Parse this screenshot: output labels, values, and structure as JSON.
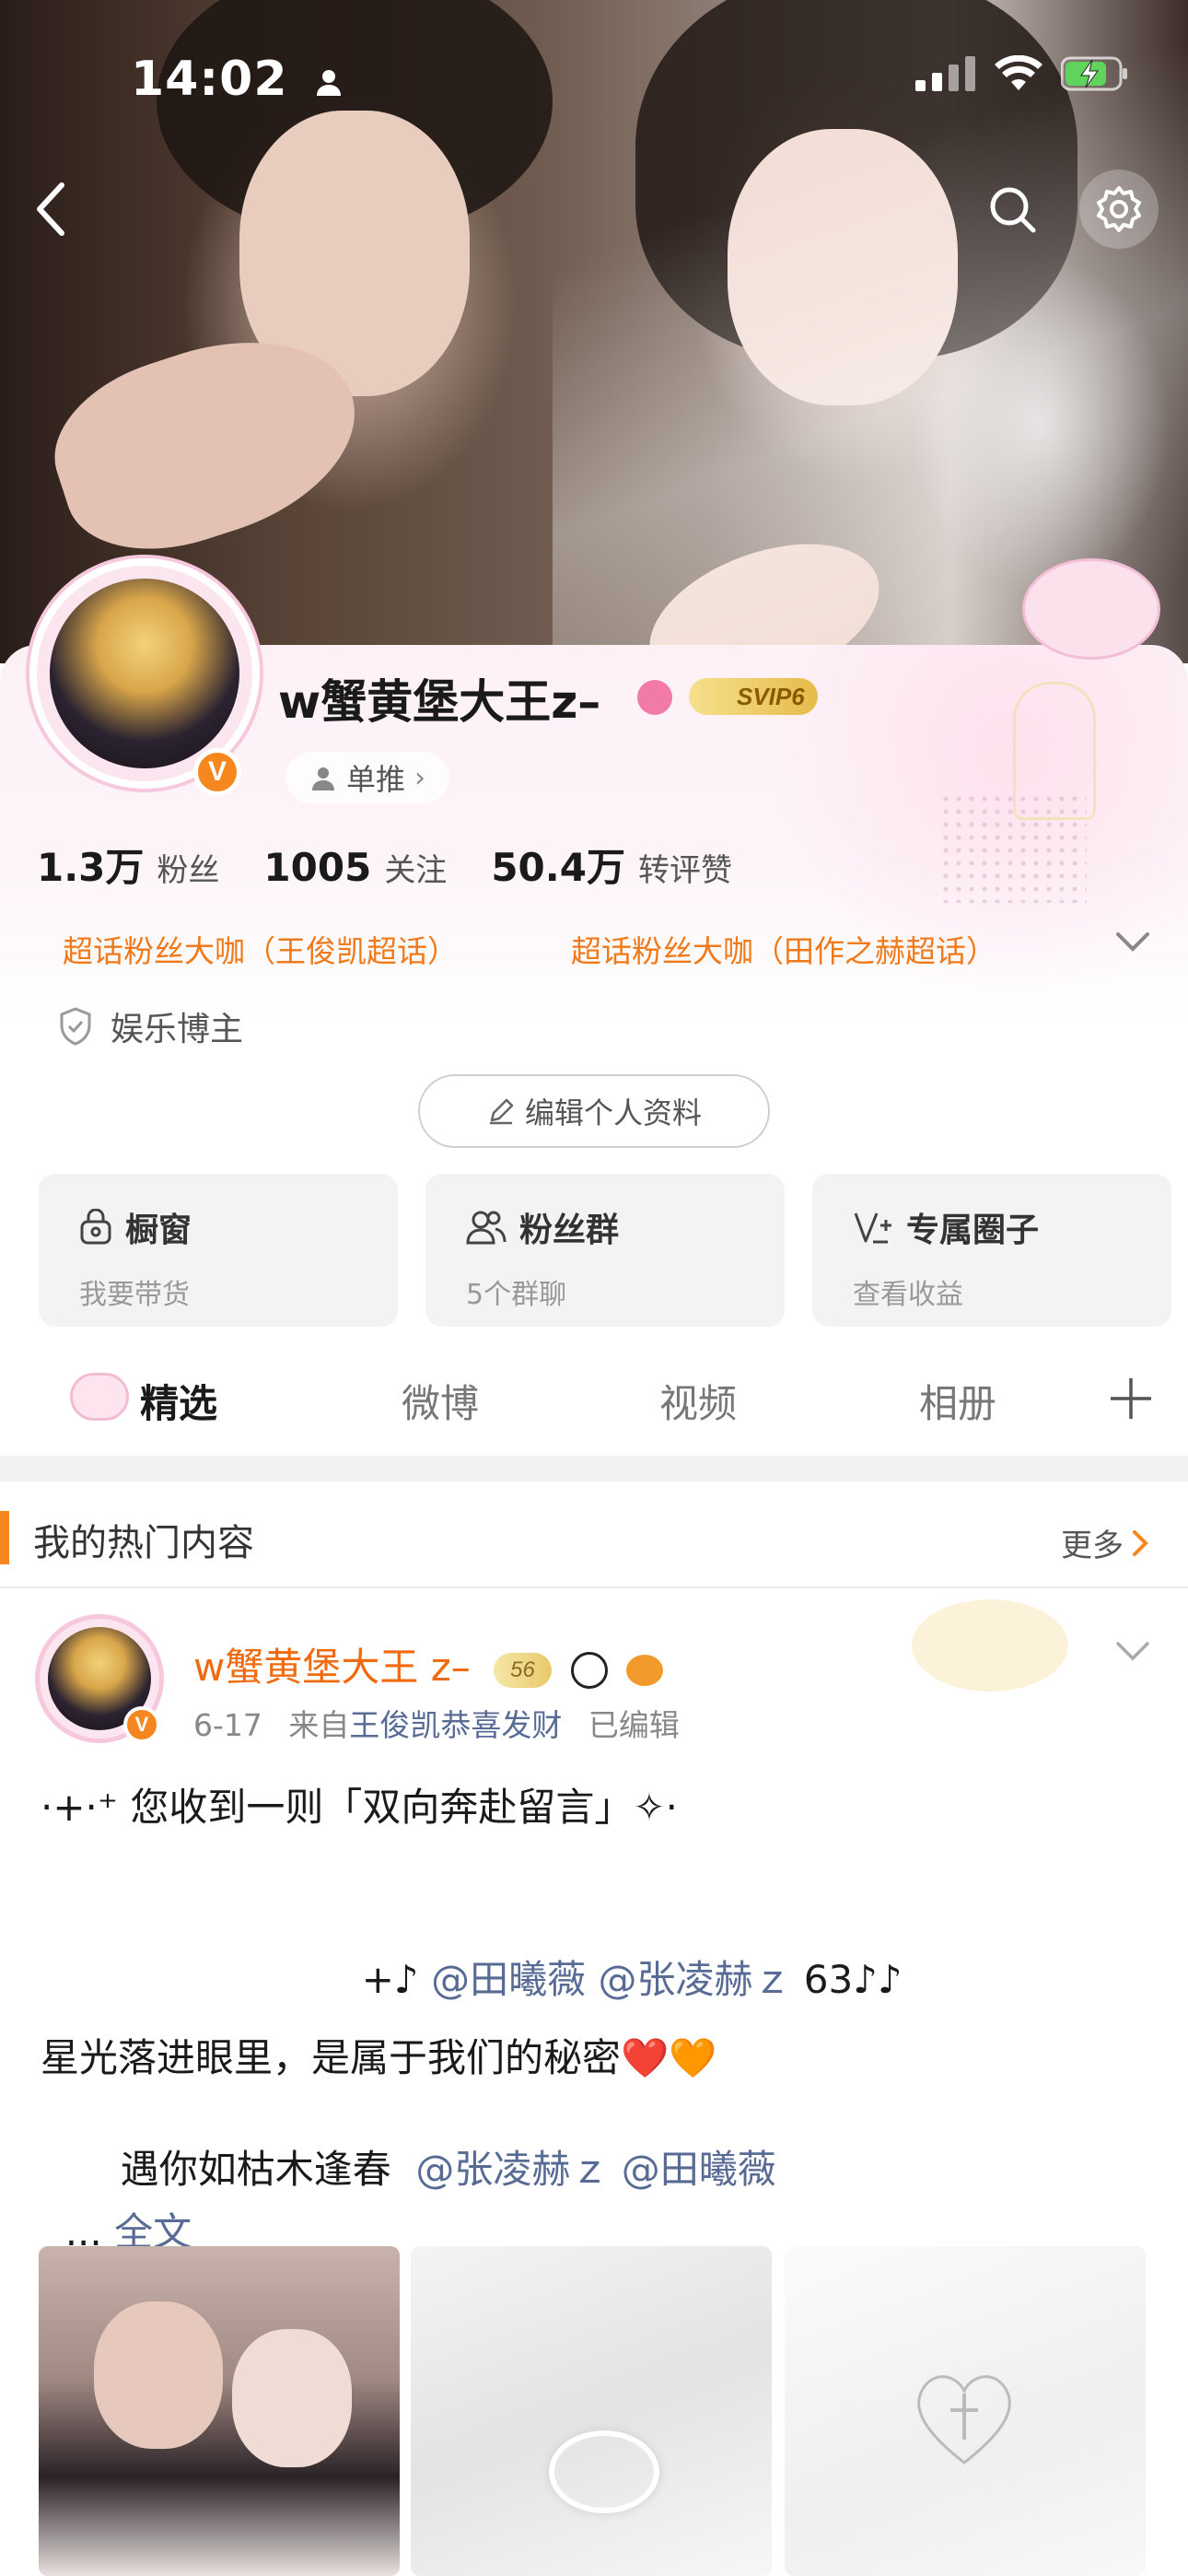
{
  "status_bar": {
    "time": "14:02"
  },
  "profile": {
    "username": "w蟹黄堡大王z–",
    "vip_badge": "SVIP6",
    "verified_mark": "V",
    "recommend_label": "单推",
    "stats": [
      {
        "value": "1.3万",
        "label": "粉丝"
      },
      {
        "value": "1005",
        "label": "关注"
      },
      {
        "value": "50.4万",
        "label": "转评赞"
      }
    ],
    "honors": [
      "超话粉丝大咖（王俊凯超话）",
      "超话粉丝大咖（田作之赫超话）"
    ],
    "category": "娱乐博主",
    "edit_button": "编辑个人资料"
  },
  "tiles": [
    {
      "title": "橱窗",
      "subtitle": "我要带货",
      "icon": "bag-icon"
    },
    {
      "title": "粉丝群",
      "subtitle": "5个群聊",
      "icon": "group-icon"
    },
    {
      "title": "专属圈子",
      "subtitle": "查看收益",
      "icon": "circle-vip-icon"
    }
  ],
  "tabs": [
    "精选",
    "微博",
    "视频",
    "相册"
  ],
  "section": {
    "title": "我的热门内容",
    "more": "更多"
  },
  "post": {
    "author": "w蟹黄堡大王 z–",
    "level_badge": "56",
    "date": "6-17",
    "from_prefix": "来自",
    "source": "王俊凯恭喜发财",
    "edited": "已编辑",
    "line1": "·+·⁺ 您收到一则「双向奔赴留言」✧·",
    "line2_prefix": "+♪ ",
    "mention1": "@田曦薇",
    "mention2": "@张凌赫ｚ",
    "line2_suffix": " 63♪♪",
    "line3": "星光落进眼里，是属于我们的秘密❤️🧡",
    "line4": "遇你如枯木逢春",
    "mention3": "@张凌赫ｚ",
    "mention4": "@田曦薇",
    "ellipsis": "... ",
    "full_text": "全文"
  },
  "colors": {
    "accent": "#f6871f",
    "honor": "#f07a1a",
    "link": "#576b95"
  }
}
